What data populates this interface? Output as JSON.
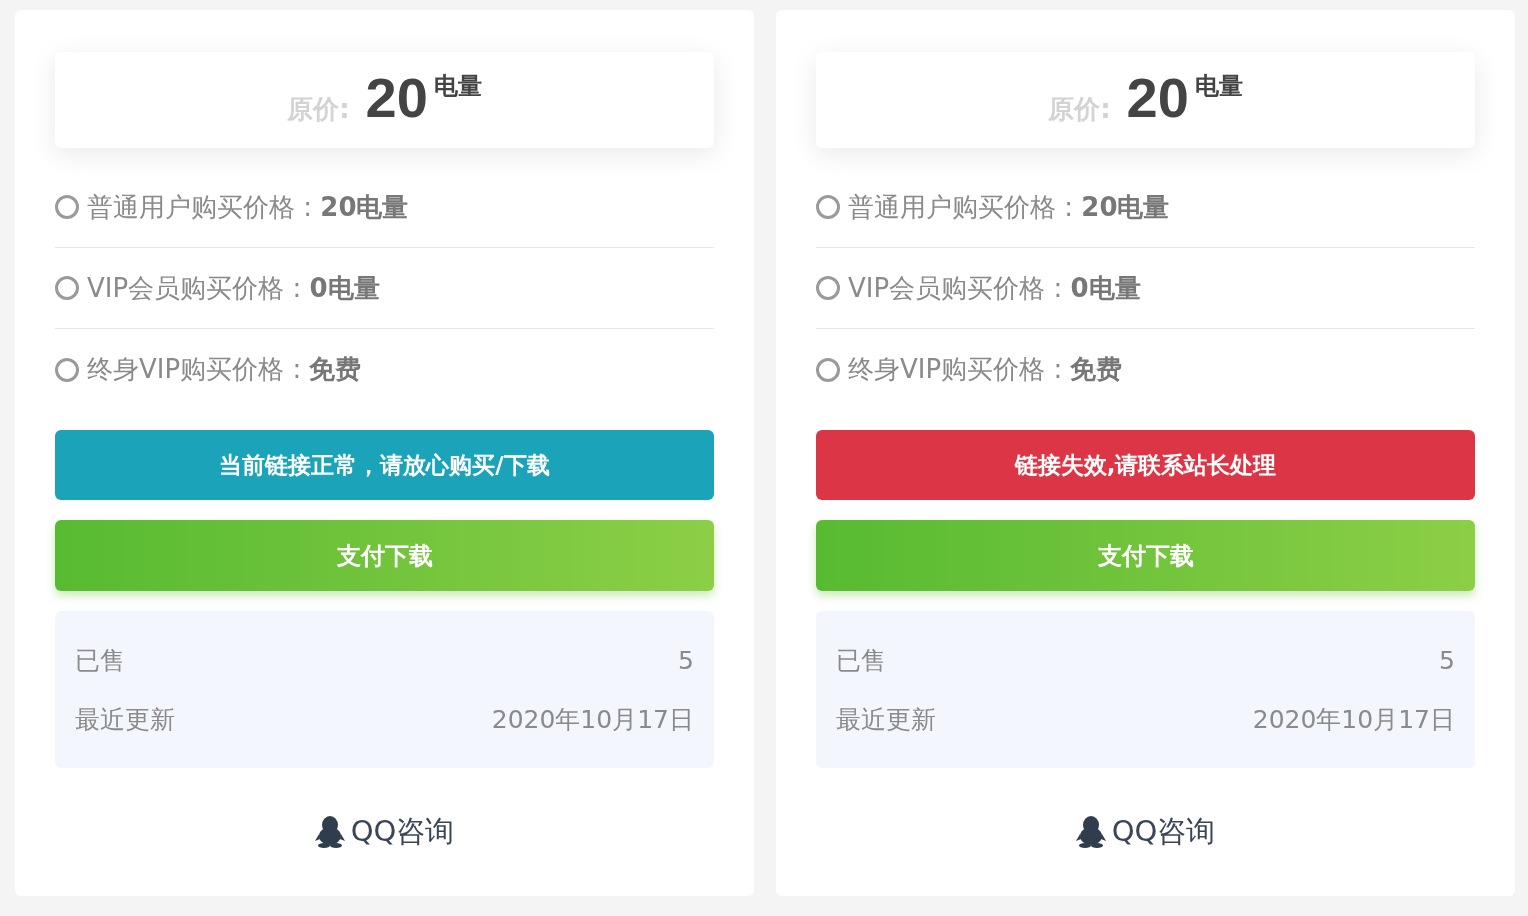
{
  "cards": [
    {
      "price_box": {
        "label": "原价:",
        "amount": "20",
        "unit": "电量"
      },
      "prices": [
        "普通用户购买价格 : **20电量**",
        "VIP会员购买价格 : **0电量**",
        "终身VIP购买价格 : **免费**"
      ],
      "link_status": {
        "kind": "ok",
        "text": "当前链接正常，请放心购买/下载"
      },
      "pay_button": "支付下载",
      "stats": [
        {
          "label": "已售",
          "value": "5"
        },
        {
          "label": "最近更新",
          "value": "2020年10月17日"
        }
      ],
      "contact": "QQ咨询"
    },
    {
      "price_box": {
        "label": "原价:",
        "amount": "20",
        "unit": "电量"
      },
      "prices": [
        "普通用户购买价格 : **20电量**",
        "VIP会员购买价格 : **0电量**",
        "终身VIP购买价格 : **免费**"
      ],
      "link_status": {
        "kind": "error",
        "text": "链接失效,请联系站长处理"
      },
      "pay_button": "支付下载",
      "stats": [
        {
          "label": "已售",
          "value": "5"
        },
        {
          "label": "最近更新",
          "value": "2020年10月17日"
        }
      ],
      "contact": "QQ咨询"
    }
  ]
}
